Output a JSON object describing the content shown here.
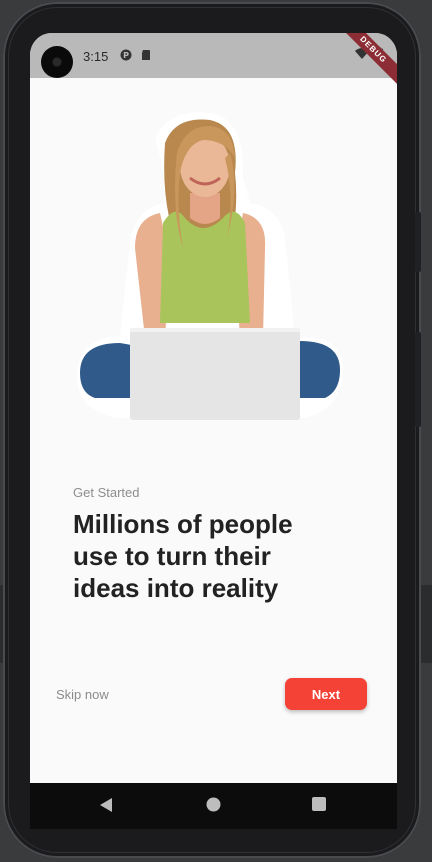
{
  "status_bar": {
    "time": "3:15",
    "debug_banner": "DEBUG",
    "icons": [
      "camera-icon",
      "app-notification-icon",
      "sd-card-icon",
      "wifi-icon",
      "battery-icon"
    ]
  },
  "onboarding": {
    "hero_image": "woman-with-laptop-illustration",
    "caption": "Get Started",
    "headline": "Millions of people use to turn their ideas into reality",
    "skip_label": "Skip now",
    "next_label": "Next"
  },
  "navigation_bar": {
    "icons": [
      "back-triangle-icon",
      "home-circle-icon",
      "recents-square-icon"
    ]
  },
  "colors": {
    "accent": "#f44336",
    "screen_bg": "#fafafa",
    "status_bar_bg": "#b9b9b9",
    "debug_ribbon": "#8c2d35"
  }
}
